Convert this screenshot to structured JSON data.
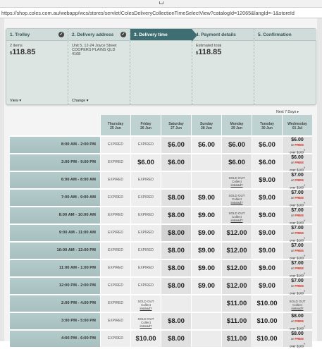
{
  "browser": {
    "url": "https://shop.coles.com.au/webapp/wcs/stores/servlet/ColesDeliveryCollectionTimeSelectView?catalogId=12065&langId=-1&storeId"
  },
  "steps": [
    {
      "label": "1. Trolley",
      "done": true,
      "line1": "2 items",
      "price_symbol": "$",
      "price": "118.85",
      "link": "View"
    },
    {
      "label": "2. Delivery address",
      "done": true,
      "address": "Unit 5, 12-24 Joyce Street COOPERS PLAINS QLD 4108",
      "link": "Change"
    },
    {
      "label": "3. Delivery time",
      "active": true
    },
    {
      "label": "4. Payment details",
      "line1": "Estimated total",
      "price_symbol": "$",
      "price": "118.85"
    },
    {
      "label": "5. Confirmation"
    }
  ],
  "next_link": "Next 7 Days",
  "days": [
    {
      "day": "Thursday",
      "date": "25 Jun"
    },
    {
      "day": "Friday",
      "date": "26 Jun"
    },
    {
      "day": "Saturday",
      "date": "27 Jun"
    },
    {
      "day": "Sunday",
      "date": "28 Jun"
    },
    {
      "day": "Monday",
      "date": "29 Jun"
    },
    {
      "day": "Tuesday",
      "date": "30 Jun"
    },
    {
      "day": "Wednesday",
      "date": "01 Jul"
    }
  ],
  "labels": {
    "expired": "EXPIRED",
    "sold_out": "SOLD OUT",
    "collect": "Collect",
    "instead": "instead?",
    "or": "or",
    "free": "FREE",
    "over": "over $100"
  },
  "slots": [
    {
      "time": "8:00 AM - 2:00 PM",
      "cells": [
        "expired",
        "expired",
        "$6.00",
        "$6.00",
        "$6.00",
        "$6.00",
        "wed:$6.00"
      ]
    },
    {
      "time": "3:00 PM - 9:00 PM",
      "cells": [
        "expired",
        "$6.00",
        "$6.00",
        "",
        "$6.00",
        "$6.00",
        "wed:$6.00"
      ]
    },
    {
      "time": "6:00 AM - 8:00 AM",
      "cells": [
        "expired",
        "expired",
        "",
        "",
        "soldout",
        "$9.00",
        "wed:$7.00"
      ]
    },
    {
      "time": "7:00 AM - 9:00 AM",
      "cells": [
        "expired",
        "expired",
        "$8.00",
        "$9.00",
        "soldout",
        "$9.00",
        "wed:$7.00"
      ]
    },
    {
      "time": "8:00 AM - 10:00 AM",
      "cells": [
        "expired",
        "expired",
        "$8.00",
        "$9.00",
        "soldout",
        "$9.00",
        "wed:$7.00"
      ]
    },
    {
      "time": "9:00 AM - 11:00 AM",
      "cells": [
        "expired",
        "expired",
        "$8.00",
        "$9.00",
        "$12.00",
        "$9.00",
        "wed:$7.00"
      ]
    },
    {
      "time": "10:00 AM - 12:00 PM",
      "cells": [
        "expired",
        "expired",
        "$8.00",
        "$9.00",
        "$12.00",
        "$9.00",
        "wed:$7.00"
      ]
    },
    {
      "time": "11:00 AM - 1:00 PM",
      "cells": [
        "expired",
        "expired",
        "$8.00",
        "$9.00",
        "$12.00",
        "$9.00",
        "wed:$7.00"
      ]
    },
    {
      "time": "12:00 PM - 2:00 PM",
      "cells": [
        "expired",
        "expired",
        "$8.00",
        "$9.00",
        "$12.00",
        "$9.00",
        "wed:$7.00"
      ]
    },
    {
      "time": "2:00 PM - 4:00 PM",
      "cells": [
        "expired",
        "soldout",
        "",
        "",
        "$11.00",
        "$10.00",
        "soldout"
      ]
    },
    {
      "time": "3:00 PM - 5:00 PM",
      "cells": [
        "expired",
        "soldout",
        "$8.00",
        "",
        "$11.00",
        "$10.00",
        "wed:$8.00"
      ]
    },
    {
      "time": "4:00 PM - 6:00 PM",
      "cells": [
        "expired",
        "$10.00",
        "$8.00",
        "",
        "$11.00",
        "$10.00",
        "wed:$8.00"
      ]
    }
  ],
  "colors": {
    "active_step": "#3f6e72",
    "time_col": "#afc7c6",
    "free_text": "#d7261b"
  }
}
